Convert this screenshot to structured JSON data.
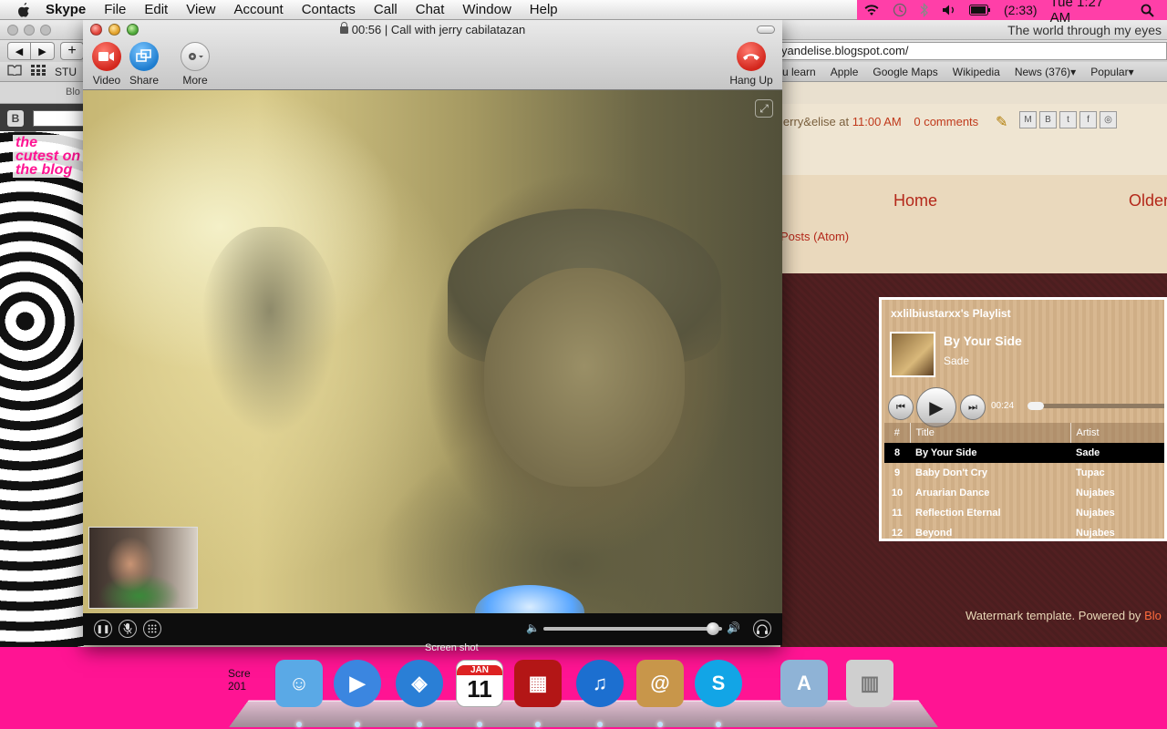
{
  "menubar": {
    "app_name": "Skype",
    "items": [
      "File",
      "Edit",
      "View",
      "Account",
      "Contacts",
      "Call",
      "Chat",
      "Window",
      "Help"
    ],
    "battery": "(2:33)",
    "clock": "Tue 1:27 AM"
  },
  "browser": {
    "title": "The world through my eyes",
    "url": "yandelise.blogspot.com/",
    "bookmarks": [
      "u learn",
      "Apple",
      "Google Maps",
      "Wikipedia",
      "News (376)▾",
      "Popular▾"
    ],
    "left_bookmark": "STU",
    "tab_fragment": "Blo"
  },
  "blog": {
    "left_logo": "the cutest on the blog",
    "byline_prefix": "jerry&elise at",
    "byline_time": "11:00 AM",
    "comments": "0 comments",
    "nav_home": "Home",
    "nav_older": "Older",
    "atom": "Posts (Atom)",
    "footer_text": "Watermark template. Powered by",
    "footer_link": "Blo"
  },
  "playlist": {
    "title": "xxlilbiustarxx's Playlist",
    "now_playing_title": "By Your Side",
    "now_playing_artist": "Sade",
    "elapsed": "00:24",
    "progress": 0.0,
    "columns": [
      "#",
      "Title",
      "Artist"
    ],
    "tracks": [
      {
        "num": "8",
        "title": "By Your Side",
        "artist": "Sade",
        "active": true
      },
      {
        "num": "9",
        "title": "Baby Don't Cry",
        "artist": "Tupac",
        "active": false
      },
      {
        "num": "10",
        "title": "Aruarian Dance",
        "artist": "Nujabes",
        "active": false
      },
      {
        "num": "11",
        "title": "Reflection Eternal",
        "artist": "Nujabes",
        "active": false
      },
      {
        "num": "12",
        "title": "Beyond",
        "artist": "Nujabes",
        "active": false
      }
    ]
  },
  "skype": {
    "window_title": "00:56 | Call with jerry cabilatazan",
    "buttons": {
      "video": "Video",
      "share": "Share",
      "more": "More",
      "hangup": "Hang Up"
    },
    "volume": 0.95
  },
  "dock": {
    "apps": [
      {
        "name": "Finder",
        "icon": "finder-icon",
        "color": "#5aa9e6"
      },
      {
        "name": "iChat",
        "icon": "ichat-icon",
        "color": "#3b86e0"
      },
      {
        "name": "Safari",
        "icon": "safari-icon",
        "color": "#2a7fd6"
      },
      {
        "name": "iCal",
        "icon": "ical-icon",
        "color": "#ffffff"
      },
      {
        "name": "Photo Booth",
        "icon": "photo-booth-icon",
        "color": "#b31616"
      },
      {
        "name": "iTunes",
        "icon": "itunes-icon",
        "color": "#1c6fd0"
      },
      {
        "name": "Address Book",
        "icon": "address-book-icon",
        "color": "#c8964a"
      },
      {
        "name": "Skype",
        "icon": "skype-icon",
        "color": "#12a5e6"
      },
      {
        "name": "Applications",
        "icon": "applications-folder-icon",
        "color": "#8fb3d6"
      },
      {
        "name": "Trash",
        "icon": "trash-icon",
        "color": "#cfcfcf"
      }
    ],
    "ical_month": "JAN",
    "ical_day": "11"
  },
  "desktop": {
    "label_left": "Scre 201",
    "label_screenshot": "Screen shot"
  }
}
